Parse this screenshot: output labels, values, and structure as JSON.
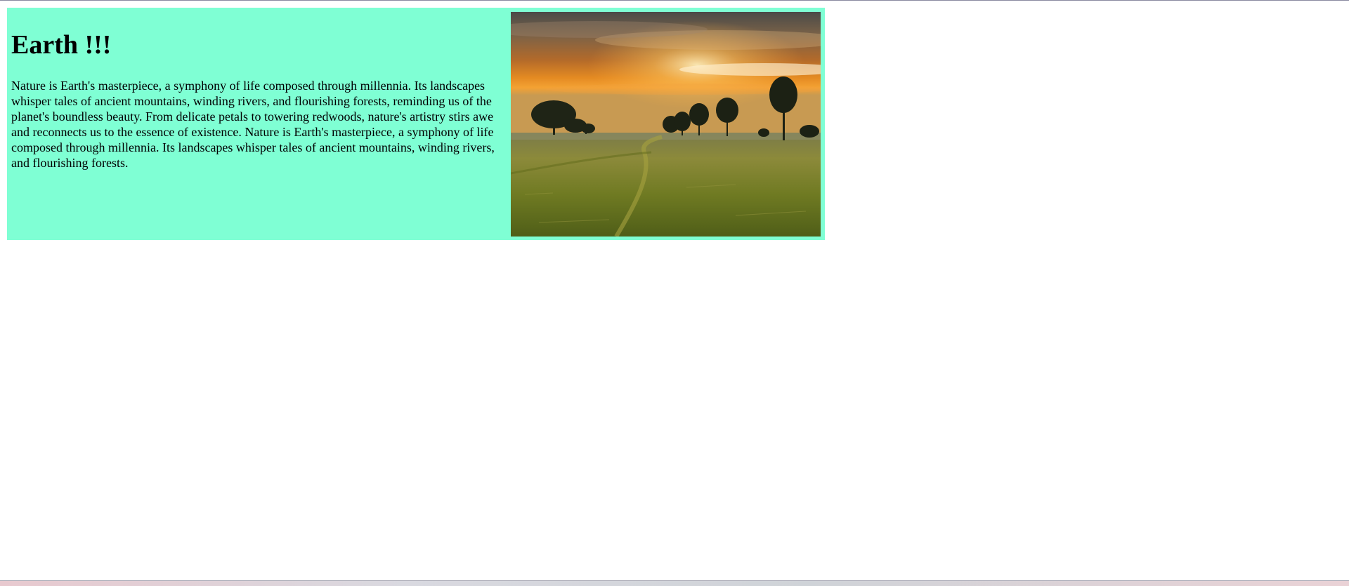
{
  "card": {
    "title": "Earth !!!",
    "paragraph": "Nature is Earth's masterpiece, a symphony of life composed through millennia. Its landscapes whisper tales of ancient mountains, winding rivers, and flourishing forests, reminding us of the planet's boundless beauty. From delicate petals to towering redwoods, nature's artistry stirs awe and reconnects us to the essence of existence. Nature is Earth's masterpiece, a symphony of life composed through millennia. Its landscapes whisper tales of ancient mountains, winding rivers, and flourishing forests.",
    "background_color": "#7fffd4"
  },
  "image": {
    "subject": "sunset-over-grass-field-with-trees"
  }
}
